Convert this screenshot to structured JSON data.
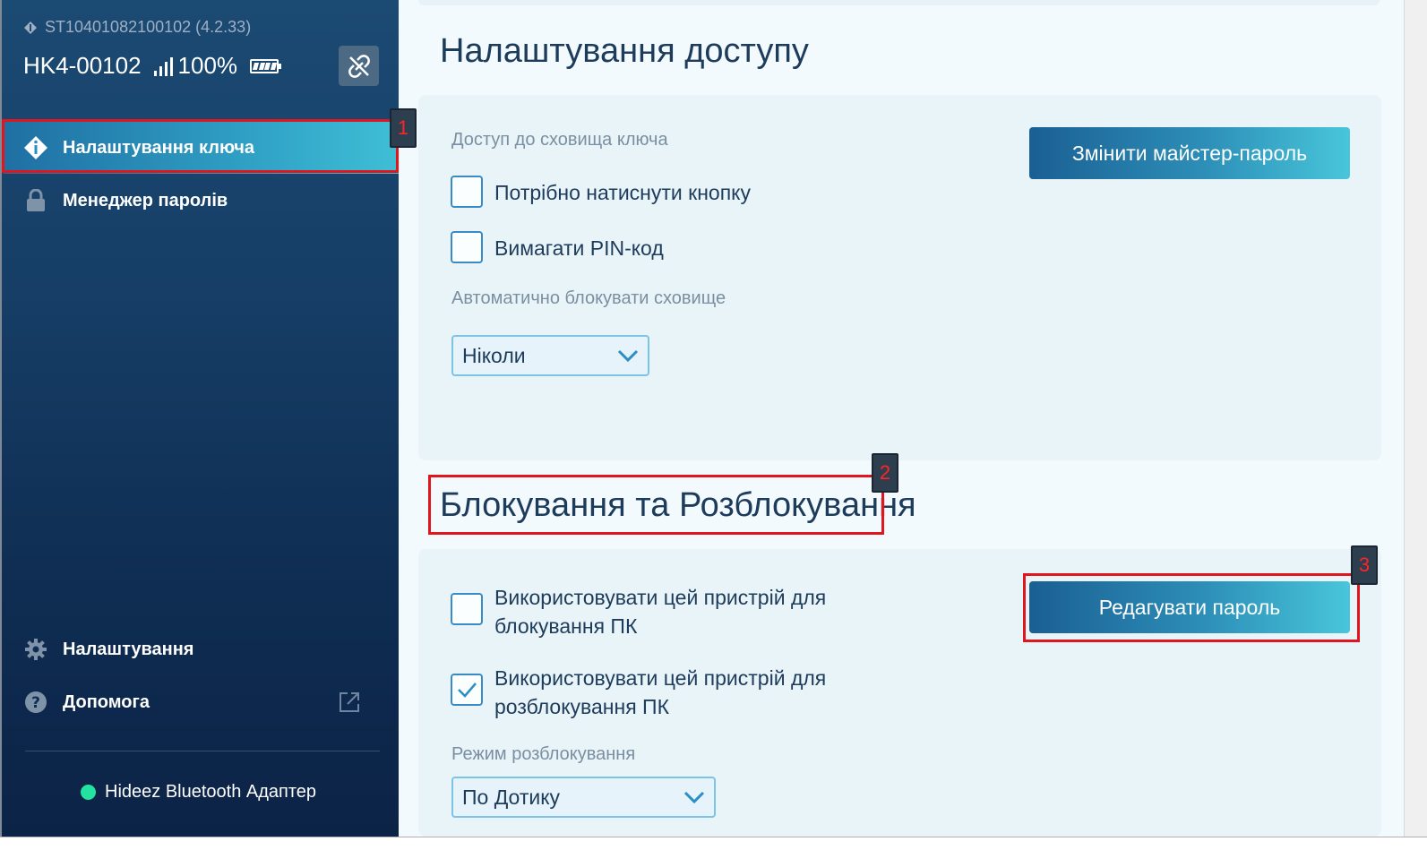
{
  "sidebar": {
    "serial": "ST10401082100102 (4.2.33)",
    "device_name": "HK4-00102",
    "battery_percent": "100%",
    "nav": [
      {
        "label": "Налаштування ключа",
        "icon": "key-diamond-icon",
        "active": true
      },
      {
        "label": "Менеджер паролів",
        "icon": "lock-icon",
        "active": false
      }
    ],
    "bottom_nav": [
      {
        "label": "Налаштування",
        "icon": "gear-icon"
      },
      {
        "label": "Допомога",
        "icon": "help-icon"
      }
    ],
    "adapter_label": "Hideez Bluetooth Адаптер",
    "adapter_status_color": "#22e3a0"
  },
  "access": {
    "title": "Налаштування доступу",
    "storage_label": "Доступ до сховища ключа",
    "change_master_password": "Змінити майстер-пароль",
    "require_button": {
      "label": "Потрібно натиснути кнопку",
      "checked": false
    },
    "require_pin": {
      "label": "Вимагати PIN-код",
      "checked": false
    },
    "autolock_label": "Автоматично блокувати сховище",
    "autolock_value": "Ніколи"
  },
  "lock": {
    "title": "Блокування та Розблокування",
    "edit_password": "Редагувати пароль",
    "lock_pc": {
      "label_line1": "Використовувати цей пристрій для",
      "label_line2": "блокування ПК",
      "checked": false
    },
    "unlock_pc": {
      "label_line1": "Використовувати цей пристрій для",
      "label_line2": "розблокування ПК",
      "checked": true
    },
    "unlock_mode_label": "Режим розблокування",
    "unlock_mode_value": "По Дотику"
  },
  "annotations": [
    "1",
    "2",
    "3"
  ],
  "colors": {
    "accent": "#2d8fb8",
    "annotation": "#e0161f"
  }
}
